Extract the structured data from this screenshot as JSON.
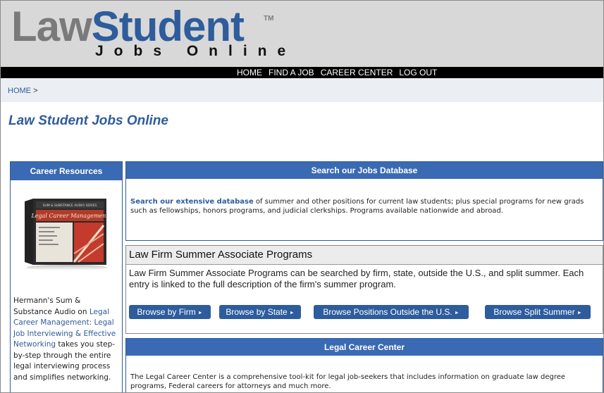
{
  "logo": {
    "main_gray": "Law",
    "main_blue": "Student",
    "tm": "TM",
    "sub": "Jobs Online"
  },
  "nav": {
    "items": [
      "HOME",
      "FIND A JOB",
      "CAREER CENTER",
      "LOG OUT"
    ]
  },
  "breadcrumb": {
    "home": "HOME",
    "sep": ">"
  },
  "page_title": "Law Student Jobs Online",
  "sidebar": {
    "title": "Career Resources",
    "product": {
      "box_top": "SUM & SUBSTANCE AUDIO SERIES",
      "box_title": "Legal Career Management"
    },
    "text_before": "Hermann's Sum & Substance Audio on ",
    "text_link": "Legal Career Management: Legal Job Interviewing & Effective Networking",
    "text_after": " takes you step-by-step through the entire legal interviewing process and simplifies networking."
  },
  "search_panel": {
    "title": "Search our Jobs Database",
    "link": "Search our extensive database",
    "text": " of summer and other positions for current law students; plus special programs for new grads such as fellowships, honors programs, and judicial clerkships. Programs available nationwide and abroad."
  },
  "law_firm_panel": {
    "title": "Law Firm Summer Associate Programs",
    "text": "Law Firm Summer Associate Programs can be searched by firm, state, outside the U.S., and split summer. Each entry is linked to the full description of the firm's summer program.",
    "buttons": [
      "Browse by Firm",
      "Browse by State",
      "Browse Positions Outside the U.S.",
      "Browse Split Summer"
    ],
    "arrow": "►"
  },
  "career_panel": {
    "title": "Legal Career Center",
    "text": "The Legal Career Center is a comprehensive tool-kit for legal job-seekers that includes information on graduate law degree programs, Federal careers for attorneys and much more."
  },
  "colors": {
    "brand_blue": "#2e5c9c",
    "header_blue": "#3a6ab3",
    "header_gray": "#d8d8d8"
  }
}
